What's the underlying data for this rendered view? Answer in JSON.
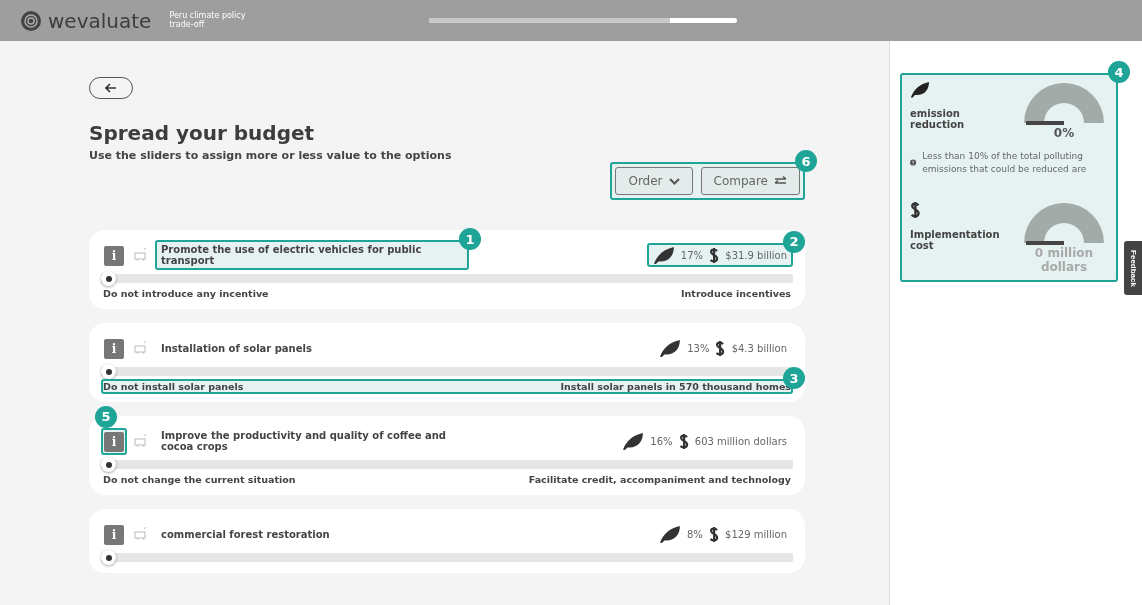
{
  "header": {
    "logo": "wevaluate",
    "subtitle": "Peru climate policy trade-off",
    "progress": {
      "level": 0.78
    }
  },
  "title": "Spread your budget",
  "subtitle": "Use the sliders  to assign more or less value to the options",
  "actions": {
    "callout": "6",
    "buttons": [
      {
        "kind": "order",
        "label": "Order"
      },
      {
        "kind": "compare",
        "label": "Compare"
      }
    ]
  },
  "options": [
    {
      "info": "i",
      "title": "Promote the use of electric vehicles for public transport",
      "impact": "17%",
      "cost": "$31.9 billion",
      "level": 0,
      "min_label": "Do not introduce any incentive",
      "max_label": "Introduce incentives",
      "title_callout": "1",
      "impact_callout": "2"
    },
    {
      "info": "i",
      "title": "Installation of solar panels",
      "impact": "13%",
      "cost": "$4.3 billion",
      "level": 0,
      "min_label": "Do not install solar panels",
      "max_label": "Install solar panels in 570 thousand homes",
      "labels_callout": "3"
    },
    {
      "info": "i",
      "title": "Improve the productivity and quality of coffee and cocoa crops",
      "impact": "16%",
      "cost": "603 million dollars",
      "level": 0,
      "min_label": "Do not change the current situation",
      "max_label": "Facilitate credit, accompaniment and technology",
      "info_callout": "5"
    },
    {
      "info": "i",
      "title": "commercial forest restoration",
      "impact": "8%",
      "cost": "$129 million",
      "level": 0
    }
  ],
  "summary": {
    "callout": "4",
    "emission": {
      "label": "emission reduction",
      "value": "0%",
      "note": "Less than 10% of the total polluting emissions that could be reduced are"
    },
    "cost": {
      "label": "Implementation cost",
      "value": "0 million dollars"
    }
  },
  "feedback": "Feedback"
}
